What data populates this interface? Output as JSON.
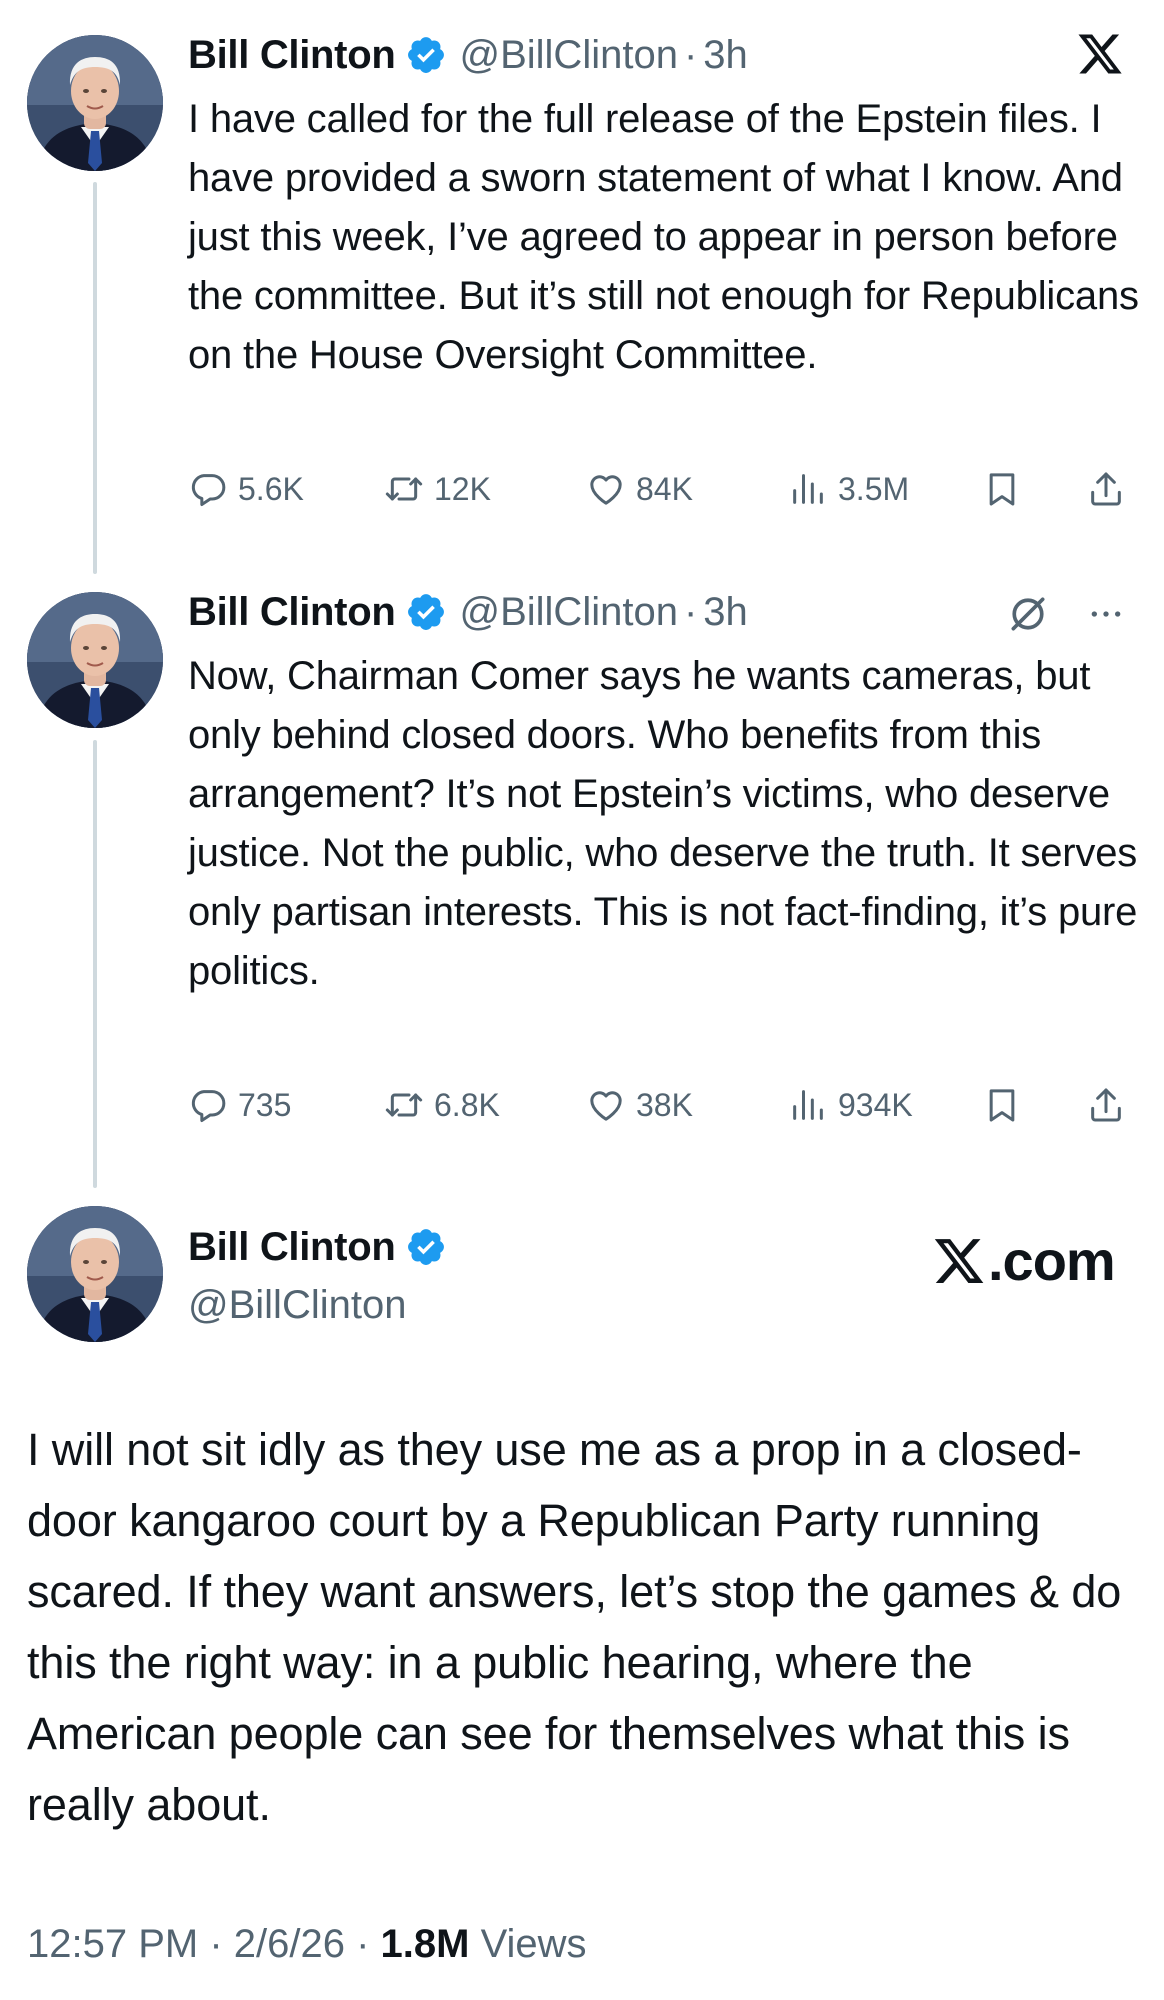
{
  "tweets": [
    {
      "name": "Bill Clinton",
      "handle": "@BillClinton",
      "sep": "·",
      "time": "3h",
      "text": "I have called for the full release of the Epstein files. I have provided a sworn statement of what I know. And just this week, I’ve agreed to appear in person before the committee. But it’s still not enough for Republicans on the House Oversight Committee.",
      "replies": "5.6K",
      "reposts": "12K",
      "likes": "84K",
      "views": "3.5M"
    },
    {
      "name": "Bill Clinton",
      "handle": "@BillClinton",
      "sep": "·",
      "time": "3h",
      "text": "Now, Chairman Comer says he wants cameras, but only behind closed doors. Who benefits from this arrangement? It’s not Epstein’s victims, who deserve justice. Not the public, who deserve the truth. It serves only partisan interests. This is not fact-finding, it’s pure politics.",
      "replies": "735",
      "reposts": "6.8K",
      "likes": "38K",
      "views": "934K"
    }
  ],
  "main_tweet": {
    "name": "Bill Clinton",
    "handle": "@BillClinton",
    "site": ".com",
    "text": "I will not sit idly as they use me as a prop in a closed-door kangaroo court by a Republican Party running scared. If they want answers, let’s stop the games & do this the right way: in a public hearing, where the American people can see for themselves what this is really about.",
    "footer_time": "12:57 PM · 2/6/26 · ",
    "footer_views_count": "1.8M",
    "footer_views_label": " Views"
  },
  "icons": {
    "verified": "verified-badge-icon",
    "reply": "reply-icon",
    "repost": "repost-icon",
    "like": "heart-icon",
    "views": "views-icon",
    "bookmark": "bookmark-icon",
    "share": "share-icon",
    "x_logo": "x-logo-icon",
    "grok": "grok-icon",
    "more": "more-icon"
  },
  "colors": {
    "verified_blue": "#1d9bf0",
    "text_primary": "#0f1419",
    "text_secondary": "#536471",
    "thread_line": "#cfd9de"
  }
}
